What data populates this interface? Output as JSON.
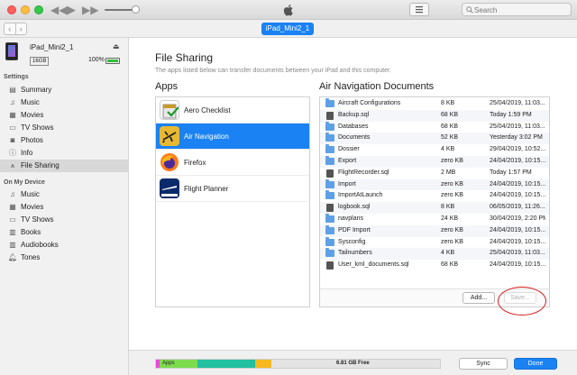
{
  "toolbar": {
    "search_placeholder": "Search"
  },
  "nav": {
    "device_pill": "iPad_Mini2_1"
  },
  "device": {
    "name": "iPad_Mini2_1",
    "capacity": "16GB",
    "battery_percent": "100%"
  },
  "sidebar": {
    "settings_header": "Settings",
    "settings_items": [
      {
        "label": "Summary",
        "icon": "summary-icon"
      },
      {
        "label": "Music",
        "icon": "music-icon"
      },
      {
        "label": "Movies",
        "icon": "movies-icon"
      },
      {
        "label": "TV Shows",
        "icon": "tv-icon"
      },
      {
        "label": "Photos",
        "icon": "photos-icon"
      },
      {
        "label": "Info",
        "icon": "info-icon"
      },
      {
        "label": "File Sharing",
        "icon": "file-sharing-icon"
      }
    ],
    "device_header": "On My Device",
    "device_items": [
      {
        "label": "Music",
        "icon": "music-icon"
      },
      {
        "label": "Movies",
        "icon": "movies-icon"
      },
      {
        "label": "TV Shows",
        "icon": "tv-icon"
      },
      {
        "label": "Books",
        "icon": "books-icon"
      },
      {
        "label": "Audiobooks",
        "icon": "audiobooks-icon"
      },
      {
        "label": "Tones",
        "icon": "tones-icon"
      }
    ],
    "active": "File Sharing"
  },
  "main": {
    "title": "File Sharing",
    "description": "The apps listed below can transfer documents between your iPad and this computer.",
    "apps_header": "Apps",
    "docs_header": "Air Navigation Documents"
  },
  "apps": [
    {
      "label": "Aero Checklist",
      "selected": false
    },
    {
      "label": "Air Navigation",
      "selected": true
    },
    {
      "label": "Firefox",
      "selected": false
    },
    {
      "label": "Flight Planner",
      "selected": false
    }
  ],
  "documents": [
    {
      "name": "Aircraft Configurations",
      "size": "8 KB",
      "date": "25/04/2019, 11:03...",
      "type": "folder"
    },
    {
      "name": "Backup.sql",
      "size": "68 KB",
      "date": "Today 1:59 PM",
      "type": "file"
    },
    {
      "name": "Databases",
      "size": "68 KB",
      "date": "25/04/2019, 11:03...",
      "type": "folder"
    },
    {
      "name": "Documents",
      "size": "52 KB",
      "date": "Yesterday 3:02 PM",
      "type": "folder"
    },
    {
      "name": "Dossier",
      "size": "4 KB",
      "date": "29/04/2019, 10:52...",
      "type": "folder"
    },
    {
      "name": "Export",
      "size": "zero KB",
      "date": "24/04/2019, 10:15...",
      "type": "folder"
    },
    {
      "name": "FlightRecorder.sql",
      "size": "2 MB",
      "date": "Today 1:57 PM",
      "type": "file"
    },
    {
      "name": "Import",
      "size": "zero KB",
      "date": "24/04/2019, 10:15...",
      "type": "folder"
    },
    {
      "name": "ImportAtLaunch",
      "size": "zero KB",
      "date": "24/04/2019, 10:15...",
      "type": "folder"
    },
    {
      "name": "logbook.sql",
      "size": "8 KB",
      "date": "06/05/2019, 11:26...",
      "type": "file"
    },
    {
      "name": "navplans",
      "size": "24 KB",
      "date": "30/04/2019, 2:20 PM",
      "type": "folder"
    },
    {
      "name": "PDF Import",
      "size": "zero KB",
      "date": "24/04/2019, 10:15...",
      "type": "folder"
    },
    {
      "name": "Sysconfig",
      "size": "zero KB",
      "date": "24/04/2019, 10:15...",
      "type": "folder"
    },
    {
      "name": "Tailnumbers",
      "size": "4 KB",
      "date": "25/04/2019, 11:03...",
      "type": "folder"
    },
    {
      "name": "User_kml_documents.sql",
      "size": "68 KB",
      "date": "24/04/2019, 10:15...",
      "type": "file"
    }
  ],
  "docs_footer": {
    "add_label": "Add...",
    "save_label": "Save..."
  },
  "bottom": {
    "apps_label": "Apps",
    "free_label": "6.81 GB Free",
    "sync_label": "Sync",
    "done_label": "Done"
  },
  "colors": {
    "accent": "#1a82f3",
    "highlight_circle": "#d81b1b",
    "storage_pink": "#e94bd8",
    "storage_green": "#7ddc4e",
    "storage_teal": "#20c0a0",
    "storage_yellow": "#f5b820"
  }
}
